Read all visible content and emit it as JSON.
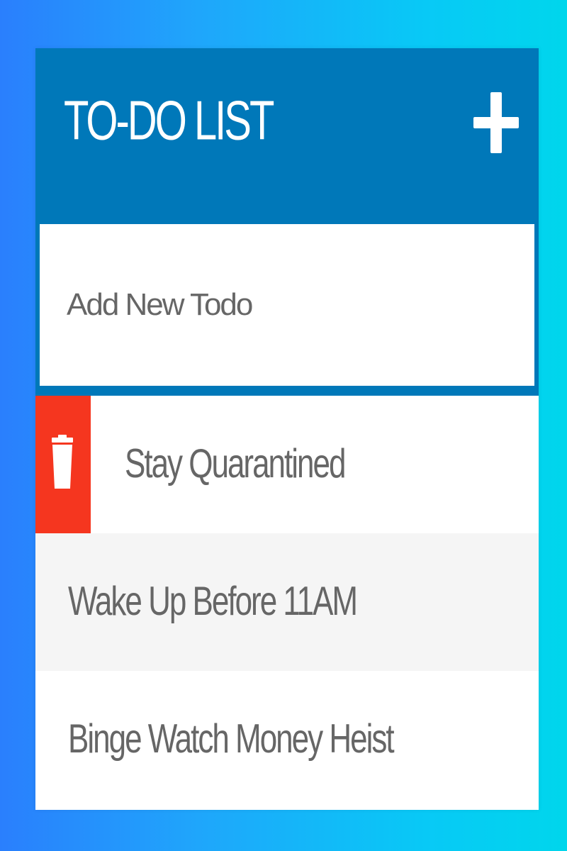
{
  "app": {
    "title": "TO-DO LIST"
  },
  "header": {
    "add_icon": "plus-icon"
  },
  "new_todo": {
    "placeholder": "Add New Todo",
    "value": ""
  },
  "todos": [
    {
      "text": "Stay Quarantined",
      "delete_icon": "trash-icon",
      "delete_visible": true
    },
    {
      "text": "Wake Up Before 11AM",
      "delete_visible": false
    },
    {
      "text": "Binge Watch Money Heist",
      "delete_visible": false
    }
  ],
  "colors": {
    "header": "#0078b9",
    "delete": "#f5361f",
    "text": "#666666",
    "row_alt": "#f5f5f5",
    "background_start": "#2a7ffd",
    "background_end": "#00d6ec"
  }
}
